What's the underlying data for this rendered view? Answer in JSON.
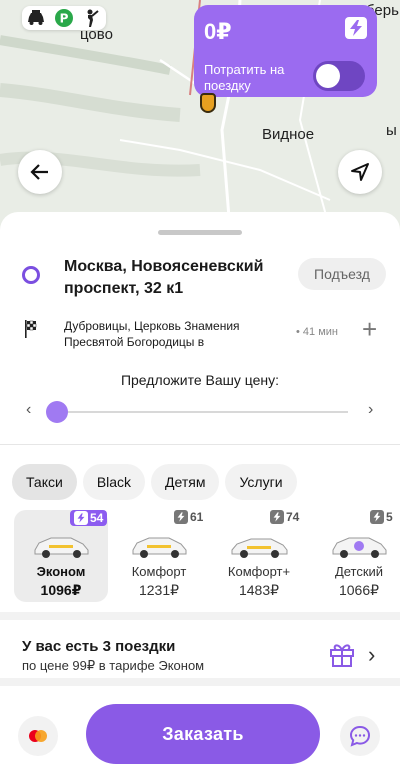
{
  "map": {
    "city_top_left": "цово",
    "city_center": "Видное",
    "city_right": "берь",
    "city_right2": "ы"
  },
  "service_icons": [
    "taxi-icon",
    "parking-icon",
    "hitch-icon"
  ],
  "cashback": {
    "amount": "0₽",
    "spend_label": "Потратить на поездку",
    "toggle_on": false,
    "accent": "#9b6bf0"
  },
  "route": {
    "from": "Москва, Новоясеневский проспект, 32 к1",
    "porch_label": "Подъезд",
    "to": "Дубровицы, Церковь Знамения Пресвятой Богородицы в",
    "to_time": "• 41 мин",
    "add": "+"
  },
  "price": {
    "title": "Предложите Вашу цену:",
    "left": "‹",
    "right": "›"
  },
  "tabs": [
    {
      "label": "Такси",
      "active": true
    },
    {
      "label": "Black",
      "active": false
    },
    {
      "label": "Детям",
      "active": false
    },
    {
      "label": "Услуги",
      "active": false
    }
  ],
  "tariffs": [
    {
      "name": "Эконом",
      "price": "1096₽",
      "badge": "54",
      "selected": true
    },
    {
      "name": "Комфорт",
      "price": "1231₽",
      "badge": "61",
      "selected": false
    },
    {
      "name": "Комфорт+",
      "price": "1483₽",
      "badge": "74",
      "selected": false
    },
    {
      "name": "Детский",
      "price": "1066₽",
      "badge": "5",
      "selected": false
    }
  ],
  "promo": {
    "title": "У вас есть 3 поездки",
    "subtitle": "по цене 99₽ в тарифе Эконом",
    "chevron": "›"
  },
  "payment": {
    "card_icon": "mastercard-icon"
  },
  "order_label": "Заказать",
  "colors": {
    "brand": "#8a5ae6"
  }
}
